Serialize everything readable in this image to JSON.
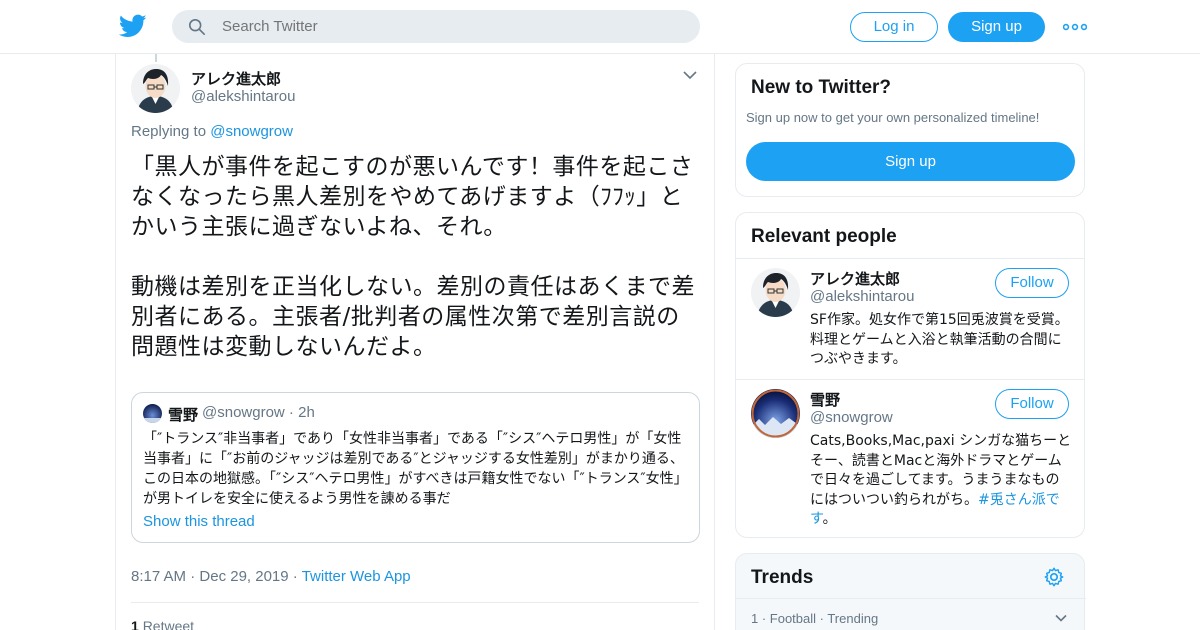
{
  "header": {
    "search_placeholder": "Search Twitter",
    "login_label": "Log in",
    "signup_label": "Sign up",
    "brand_color": "#1da1f2"
  },
  "tweet": {
    "display_name": "アレク進太郎",
    "handle": "@alekshintarou",
    "replying_prefix": "Replying to ",
    "replying_to": "@snowgrow",
    "text": "「黒人が事件を起こすのが悪いんです！事件を起こさなくなったら黒人差別をやめてあげますよ（ﾌﾌｯ」とかいう主張に過ぎないよね、それ。\n\n動機は差別を正当化しない。差別の責任はあくまで差別者にある。主張者/批判者の属性次第で差別言説の問題性は変動しないんだよ。",
    "time": "8:17 AM",
    "date": "Dec 29, 2019",
    "app": "Twitter Web App",
    "retweet_count": "1",
    "retweet_label": "Retweet"
  },
  "quote": {
    "name": "雪野",
    "handle": "@snowgrow",
    "age": "2h",
    "text": "「″トランス″非当事者」であり「女性非当事者」である「″シス″ヘテロ男性」が「女性当事者」に「″お前のジャッジは差別である″とジャッジする女性差別」がまかり通る、この日本の地獄感。「″シス″ヘテロ男性」がすべきは戸籍女性でない「″トランス″女性」が男トイレを安全に使えるよう男性を諌める事だ",
    "show_thread": "Show this thread"
  },
  "sidebar": {
    "new": {
      "title": "New to Twitter?",
      "subtitle": "Sign up now to get your own personalized timeline!",
      "signup_label": "Sign up"
    },
    "relevant": {
      "title": "Relevant people",
      "people": [
        {
          "name": "アレク進太郎",
          "handle": "@alekshintarou",
          "bio": "SF作家。処女作で第15回兎波賞を受賞。料理とゲームと入浴と執筆活動の合間につぶやきます。",
          "follow_label": "Follow"
        },
        {
          "name": "雪野",
          "handle": "@snowgrow",
          "bio_text": "Cats,Books,Mac,paxi シンガな猫ちーとそー、読書とMacと海外ドラマとゲームで日々を過ごしてます。うまうまなものにはついつい釣られがち。",
          "bio_tag": "#兎さん派です",
          "bio_end": "。",
          "follow_label": "Follow"
        }
      ]
    },
    "trends": {
      "title": "Trends",
      "first_row": "1 · Football · Trending"
    }
  }
}
